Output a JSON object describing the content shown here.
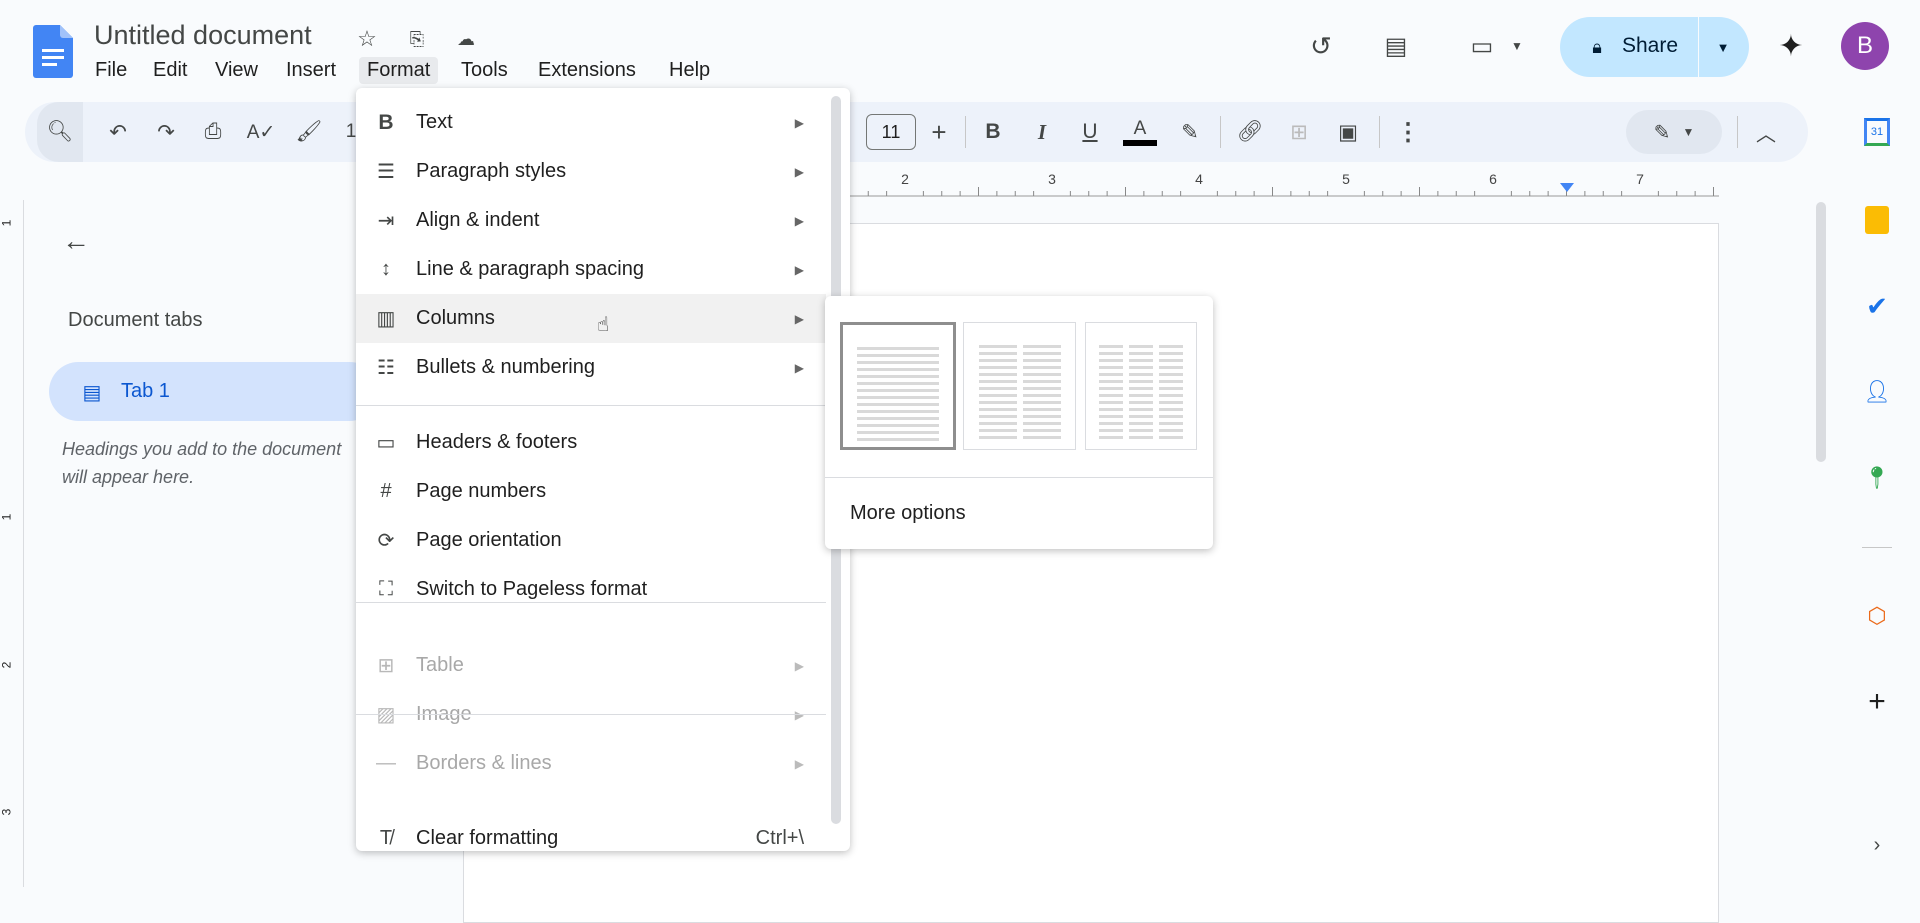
{
  "title": "Untitled document",
  "menubar": [
    "File",
    "Edit",
    "View",
    "Insert",
    "Format",
    "Tools",
    "Extensions",
    "Help"
  ],
  "header": {
    "share_label": "Share",
    "avatar_initial": "B"
  },
  "toolbar": {
    "zoom_partial": "1",
    "font_size": "11"
  },
  "ruler": {
    "numbers": [
      "2",
      "3",
      "4",
      "5",
      "6",
      "7"
    ],
    "left_numbers": [
      "1",
      "1",
      "2",
      "3"
    ]
  },
  "left_panel": {
    "heading": "Document tabs",
    "tab_label": "Tab 1",
    "hint": "Headings you add to the document will appear here."
  },
  "format_menu": {
    "items": [
      {
        "label": "Text",
        "icon": "bold-icon"
      },
      {
        "label": "Paragraph styles",
        "icon": "paragraph-icon"
      },
      {
        "label": "Align & indent",
        "icon": "indent-icon"
      },
      {
        "label": "Line & paragraph spacing",
        "icon": "line-spacing-icon"
      },
      {
        "label": "Columns",
        "icon": "columns-icon"
      },
      {
        "label": "Bullets & numbering",
        "icon": "list-icon"
      },
      {
        "label": "Headers & footers",
        "icon": "header-footer-icon"
      },
      {
        "label": "Page numbers",
        "icon": "hash-icon"
      },
      {
        "label": "Page orientation",
        "icon": "page-orientation-icon"
      },
      {
        "label": "Switch to Pageless format",
        "icon": "pageless-icon"
      },
      {
        "label": "Table",
        "icon": "table-icon"
      },
      {
        "label": "Image",
        "icon": "image-icon"
      },
      {
        "label": "Borders & lines",
        "icon": "borders-icon"
      },
      {
        "label": "Clear formatting",
        "icon": "clear-format-icon",
        "shortcut": "Ctrl+\\"
      }
    ]
  },
  "columns_submenu": {
    "more_options": "More options",
    "selected_columns": 1
  },
  "colors": {
    "accent": "#0b57d0",
    "share_bg": "#c2e7ff",
    "avatar": "#8e44ad"
  }
}
